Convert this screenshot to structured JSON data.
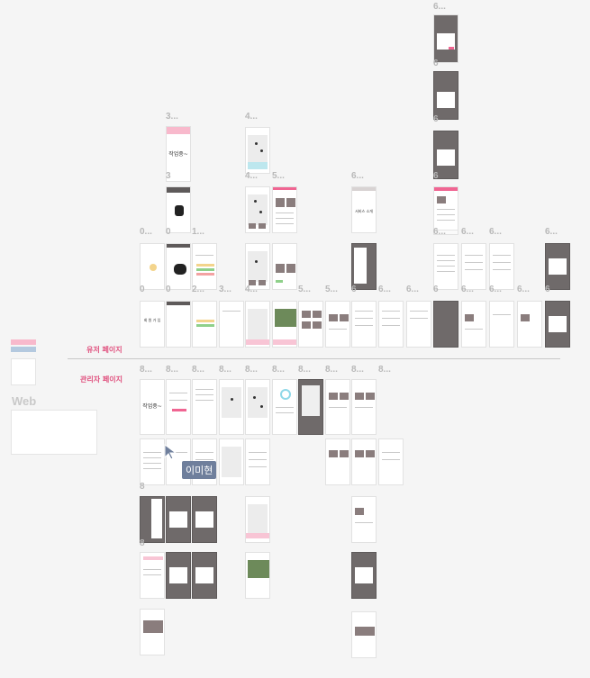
{
  "labels": {
    "user_page": "유저 페이지",
    "admin_page": "관리자 페이지",
    "web": "Web",
    "collaborator": "이미현",
    "wip": "작업중~",
    "wip_short": "작업중",
    "service_intro": "서비스 소개",
    "signup": "회 원 가 입",
    "ellipsis_6": "6...",
    "ellipsis_3": "3...",
    "ellipsis_4": "4...",
    "ellipsis_5": "5...",
    "ellipsis_0": "0...",
    "ellipsis_1": "1...",
    "ellipsis_2": "2...",
    "ellipsis_8": "8...",
    "digit_3": "3",
    "digit_6": "6",
    "digit_0": "0",
    "digit_8": "8"
  },
  "colors": {
    "accent_pink": "#f06592",
    "background": "#f5f5f5",
    "frame_dark": "#6f6a6a",
    "cursor_badge": "#6f7f9c"
  },
  "icons": {
    "cursor": "cursor-arrow-icon"
  }
}
